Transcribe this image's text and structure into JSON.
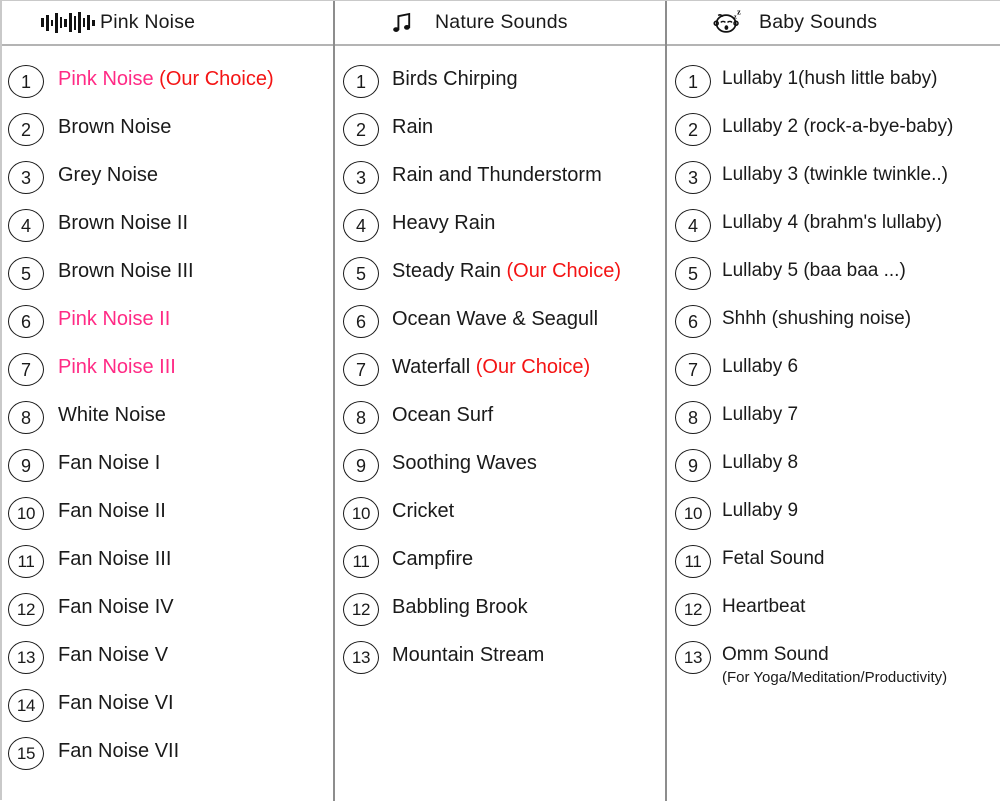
{
  "columns": [
    {
      "id": "pink-noise",
      "title": "Pink Noise",
      "icon": "waveform-icon",
      "items": [
        {
          "n": "1",
          "text": "Pink Noise ",
          "text_color": "pink",
          "tag": "(Our Choice)",
          "sub": ""
        },
        {
          "n": "2",
          "text": "Brown Noise",
          "text_color": "black",
          "tag": "",
          "sub": ""
        },
        {
          "n": "3",
          "text": "Grey Noise",
          "text_color": "black",
          "tag": "",
          "sub": ""
        },
        {
          "n": "4",
          "text": "Brown Noise II",
          "text_color": "black",
          "tag": "",
          "sub": ""
        },
        {
          "n": "5",
          "text": "Brown Noise III",
          "text_color": "black",
          "tag": "",
          "sub": ""
        },
        {
          "n": "6",
          "text": "Pink Noise II",
          "text_color": "pink",
          "tag": "",
          "sub": ""
        },
        {
          "n": "7",
          "text": "Pink Noise III",
          "text_color": "pink",
          "tag": "",
          "sub": ""
        },
        {
          "n": "8",
          "text": "White Noise",
          "text_color": "black",
          "tag": "",
          "sub": ""
        },
        {
          "n": "9",
          "text": "Fan Noise I",
          "text_color": "black",
          "tag": "",
          "sub": ""
        },
        {
          "n": "10",
          "text": "Fan Noise II",
          "text_color": "black",
          "tag": "",
          "sub": ""
        },
        {
          "n": "11",
          "text": "Fan Noise III",
          "text_color": "black",
          "tag": "",
          "sub": ""
        },
        {
          "n": "12",
          "text": "Fan Noise IV",
          "text_color": "black",
          "tag": "",
          "sub": ""
        },
        {
          "n": "13",
          "text": "Fan Noise V",
          "text_color": "black",
          "tag": "",
          "sub": ""
        },
        {
          "n": "14",
          "text": "Fan Noise VI",
          "text_color": "black",
          "tag": "",
          "sub": ""
        },
        {
          "n": "15",
          "text": "Fan Noise VII",
          "text_color": "black",
          "tag": "",
          "sub": ""
        }
      ]
    },
    {
      "id": "nature-sounds",
      "title": "Nature Sounds",
      "icon": "music-note-icon",
      "items": [
        {
          "n": "1",
          "text": "Birds Chirping",
          "text_color": "black",
          "tag": "",
          "sub": ""
        },
        {
          "n": "2",
          "text": "Rain",
          "text_color": "black",
          "tag": "",
          "sub": ""
        },
        {
          "n": "3",
          "text": "Rain and Thunderstorm",
          "text_color": "black",
          "tag": "",
          "sub": ""
        },
        {
          "n": "4",
          "text": "Heavy Rain",
          "text_color": "black",
          "tag": "",
          "sub": ""
        },
        {
          "n": "5",
          "text": "Steady Rain ",
          "text_color": "black",
          "tag": "(Our Choice)",
          "sub": ""
        },
        {
          "n": "6",
          "text": "Ocean Wave & Seagull",
          "text_color": "black",
          "tag": "",
          "sub": ""
        },
        {
          "n": "7",
          "text": "Waterfall ",
          "text_color": "black",
          "tag": "(Our Choice)",
          "sub": ""
        },
        {
          "n": "8",
          "text": "Ocean Surf",
          "text_color": "black",
          "tag": "",
          "sub": ""
        },
        {
          "n": "9",
          "text": "Soothing Waves",
          "text_color": "black",
          "tag": "",
          "sub": ""
        },
        {
          "n": "10",
          "text": "Cricket",
          "text_color": "black",
          "tag": "",
          "sub": ""
        },
        {
          "n": "11",
          "text": "Campfire",
          "text_color": "black",
          "tag": "",
          "sub": ""
        },
        {
          "n": "12",
          "text": "Babbling Brook",
          "text_color": "black",
          "tag": "",
          "sub": ""
        },
        {
          "n": "13",
          "text": "Mountain Stream",
          "text_color": "black",
          "tag": "",
          "sub": ""
        }
      ]
    },
    {
      "id": "baby-sounds",
      "title": "Baby Sounds",
      "icon": "sleeping-baby-icon",
      "items": [
        {
          "n": "1",
          "text": "Lullaby 1(hush little baby)",
          "text_color": "black",
          "tag": "",
          "sub": ""
        },
        {
          "n": "2",
          "text": "Lullaby 2 (rock-a-bye-baby)",
          "text_color": "black",
          "tag": "",
          "sub": ""
        },
        {
          "n": "3",
          "text": "Lullaby 3 (twinkle twinkle..)",
          "text_color": "black",
          "tag": "",
          "sub": ""
        },
        {
          "n": "4",
          "text": "Lullaby 4 (brahm's lullaby)",
          "text_color": "black",
          "tag": "",
          "sub": ""
        },
        {
          "n": "5",
          "text": "Lullaby 5 (baa baa ...)",
          "text_color": "black",
          "tag": "",
          "sub": ""
        },
        {
          "n": "6",
          "text": "Shhh (shushing noise)",
          "text_color": "black",
          "tag": "",
          "sub": ""
        },
        {
          "n": "7",
          "text": "Lullaby 6",
          "text_color": "black",
          "tag": "",
          "sub": ""
        },
        {
          "n": "8",
          "text": "Lullaby 7",
          "text_color": "black",
          "tag": "",
          "sub": ""
        },
        {
          "n": "9",
          "text": "Lullaby 8",
          "text_color": "black",
          "tag": "",
          "sub": ""
        },
        {
          "n": "10",
          "text": "Lullaby 9",
          "text_color": "black",
          "tag": "",
          "sub": ""
        },
        {
          "n": "11",
          "text": "Fetal Sound",
          "text_color": "black",
          "tag": "",
          "sub": ""
        },
        {
          "n": "12",
          "text": "Heartbeat",
          "text_color": "black",
          "tag": "",
          "sub": ""
        },
        {
          "n": "13",
          "text": "Omm Sound",
          "text_color": "black",
          "tag": "",
          "sub": "(For Yoga/Meditation/Productivity)"
        }
      ]
    }
  ],
  "colors": {
    "pink": "#ff2b85",
    "choice_red": "#f41414",
    "text": "#1a1a1a",
    "divider": "#8d8d8d"
  }
}
